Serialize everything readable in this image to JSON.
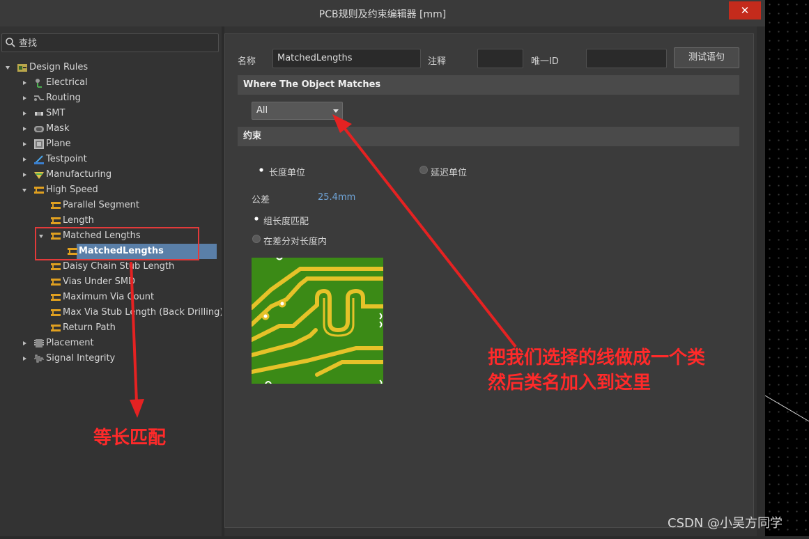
{
  "window": {
    "title": "PCB规则及约束编辑器 [mm]",
    "close_glyph": "✕"
  },
  "search": {
    "placeholder": "查找"
  },
  "tree": {
    "items": [
      {
        "label": "Design Rules",
        "icon": "design-rules-icon"
      },
      {
        "label": "Electrical",
        "icon": "electrical-icon"
      },
      {
        "label": "Routing",
        "icon": "routing-icon"
      },
      {
        "label": "SMT",
        "icon": "smt-icon"
      },
      {
        "label": "Mask",
        "icon": "mask-icon"
      },
      {
        "label": "Plane",
        "icon": "plane-icon"
      },
      {
        "label": "Testpoint",
        "icon": "testpoint-icon"
      },
      {
        "label": "Manufacturing",
        "icon": "manufacturing-icon"
      },
      {
        "label": "High Speed",
        "icon": "high-speed-icon"
      },
      {
        "label": "Parallel Segment",
        "icon": "rule-icon"
      },
      {
        "label": "Length",
        "icon": "rule-icon"
      },
      {
        "label": "Matched Lengths",
        "icon": "rule-icon"
      },
      {
        "label": "MatchedLengths",
        "icon": "rule-icon"
      },
      {
        "label": "Daisy Chain Stub Length",
        "icon": "rule-icon"
      },
      {
        "label": "Vias Under SMD",
        "icon": "rule-icon"
      },
      {
        "label": "Maximum Via Count",
        "icon": "rule-icon"
      },
      {
        "label": "Max Via Stub Length (Back Drilling)",
        "icon": "rule-icon"
      },
      {
        "label": "Return Path",
        "icon": "rule-icon"
      },
      {
        "label": "Placement",
        "icon": "placement-icon"
      },
      {
        "label": "Signal Integrity",
        "icon": "signal-integrity-icon"
      }
    ],
    "selected": "MatchedLengths"
  },
  "form": {
    "name_label": "名称",
    "name_value": "MatchedLengths",
    "comment_label": "注释",
    "comment_value": "",
    "uid_label": "唯一ID",
    "uid_value": "",
    "test_query_button": "测试语句"
  },
  "where_section": {
    "title": "Where The Object Matches",
    "dropdown_value": "All"
  },
  "constraints": {
    "title": "约束",
    "unit_length": "长度单位",
    "unit_delay": "延迟单位",
    "unit_selected": "长度单位",
    "tolerance_label": "公差",
    "tolerance_value": "25.4mm",
    "match_group": "组长度匹配",
    "match_diff": "在差分对长度内",
    "match_selected": "组长度匹配"
  },
  "annotations": {
    "left_note": "等长匹配",
    "right_note_line1": "把我们选择的线做成一个类",
    "right_note_line2": "然后类名加入到这里"
  },
  "watermark": "CSDN @小吴方同学",
  "colors": {
    "selection": "#5a7fa8",
    "annotation_red": "#ff2a2a",
    "board_green": "#3b8a16",
    "trace_yellow": "#e6c229",
    "close_red": "#c42b1c"
  }
}
